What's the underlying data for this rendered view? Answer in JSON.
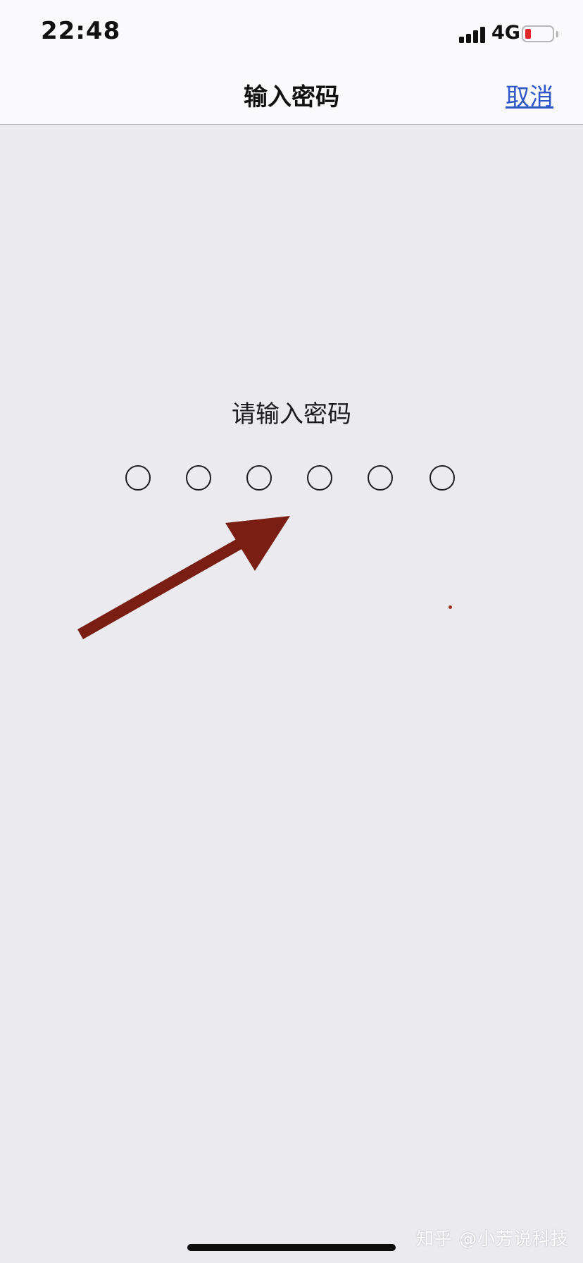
{
  "status_bar": {
    "time": "22:48",
    "network": "4G",
    "signal_icon": "cellular-signal-icon",
    "battery_icon": "battery-low-icon",
    "battery_color": "#e02a2a"
  },
  "nav": {
    "title": "输入密码",
    "cancel_label": "取消",
    "accent_color": "#2b55c8"
  },
  "content": {
    "prompt": "请输入密码",
    "passcode_slots": 6,
    "passcode_filled": 0
  },
  "annotation": {
    "arrow_icon": "arrow-annotation-icon",
    "arrow_color": "#7a1e14"
  },
  "watermark": "知乎 @小芳说科技"
}
